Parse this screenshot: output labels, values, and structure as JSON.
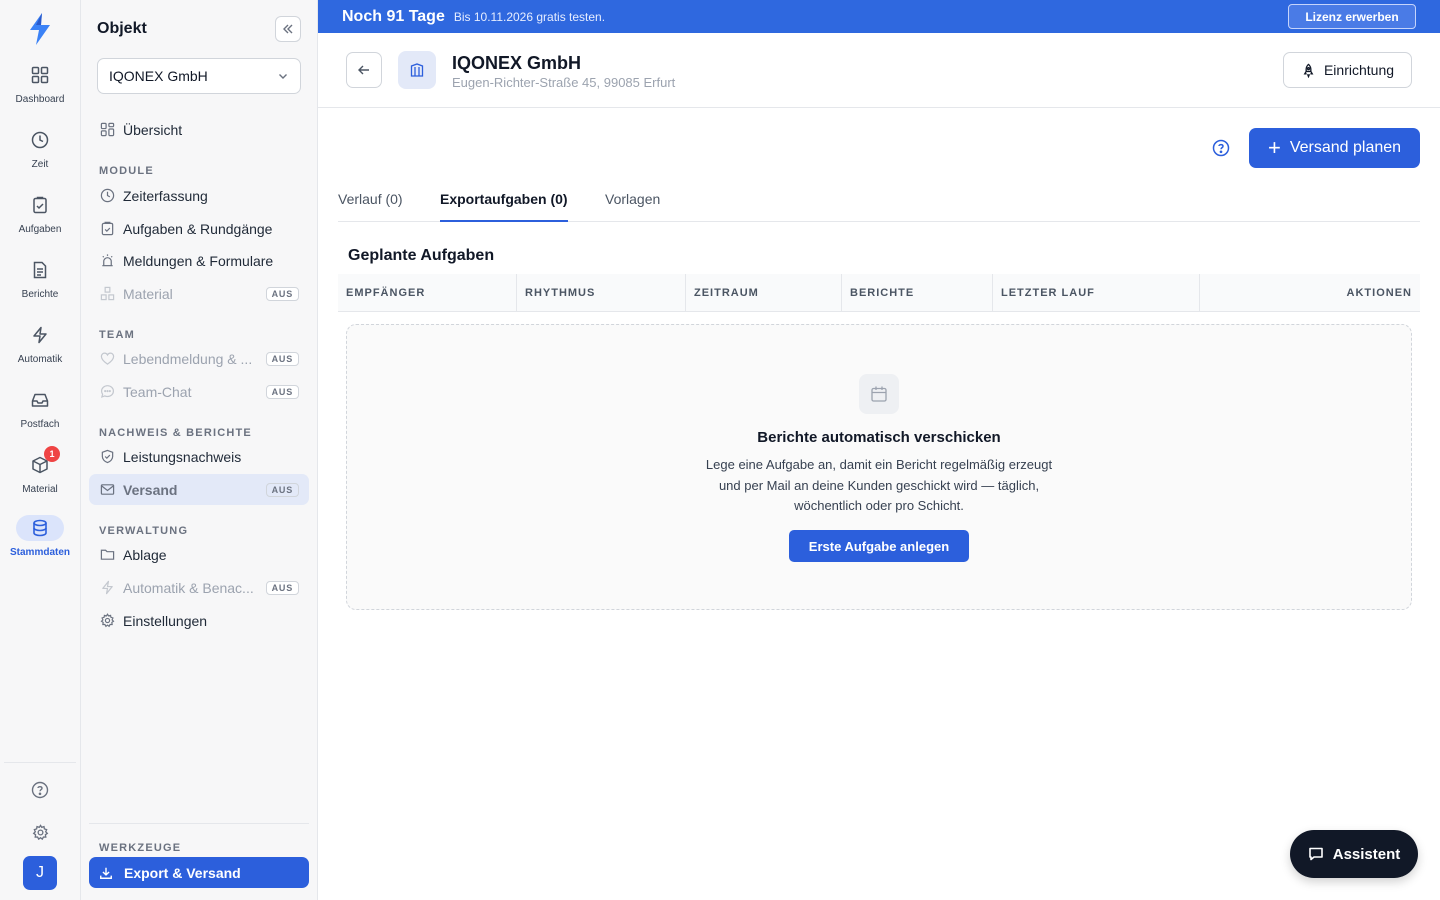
{
  "banner": {
    "title": "Noch 91 Tage",
    "subtitle": "Bis 10.11.2026 gratis testen.",
    "cta": "Lizenz erwerben"
  },
  "rail": {
    "items": [
      {
        "label": "Dashboard",
        "icon": "dashboard-icon"
      },
      {
        "label": "Zeit",
        "icon": "clock-icon"
      },
      {
        "label": "Aufgaben",
        "icon": "clipboard-icon"
      },
      {
        "label": "Berichte",
        "icon": "document-icon"
      },
      {
        "label": "Automatik",
        "icon": "bolt-icon"
      },
      {
        "label": "Postfach",
        "icon": "inbox-icon"
      },
      {
        "label": "Material",
        "icon": "box-icon",
        "badge": "1"
      },
      {
        "label": "Stammdaten",
        "icon": "database-icon",
        "active": true
      }
    ],
    "avatar": "J"
  },
  "panel": {
    "title": "Objekt",
    "selected_object": "IQONEX GmbH",
    "overview": "Übersicht",
    "sections": {
      "module": "MODULE",
      "team": "TEAM",
      "nachweis": "NACHWEIS & BERICHTE",
      "verwaltung": "VERWALTUNG",
      "werkzeuge": "WERKZEUGE"
    },
    "items": {
      "zeiterfassung": "Zeiterfassung",
      "aufgaben": "Aufgaben & Rundgänge",
      "meldungen": "Meldungen & Formulare",
      "material": "Material",
      "lebendmeldung": "Lebendmeldung & ...",
      "teamchat": "Team-Chat",
      "leistungsnachweis": "Leistungsnachweis",
      "versand": "Versand",
      "ablage": "Ablage",
      "automatik": "Automatik & Benac...",
      "einstellungen": "Einstellungen"
    },
    "off_badge": "AUS",
    "export": "Export & Versand"
  },
  "header": {
    "name": "IQONEX GmbH",
    "address": "Eugen-Richter-Straße 45, 99085 Erfurt",
    "setup_button": "Einrichtung"
  },
  "main": {
    "primary_button": "Versand planen",
    "tabs": [
      "Verlauf (0)",
      "Exportaufgaben (0)",
      "Vorlagen"
    ],
    "active_tab": "Exportaufgaben (0)",
    "section_title": "Geplante Aufgaben",
    "columns": [
      "EMPFÄNGER",
      "RHYTHMUS",
      "ZEITRAUM",
      "BERICHTE",
      "LETZTER LAUF",
      "AKTIONEN"
    ],
    "empty": {
      "title": "Berichte automatisch verschicken",
      "text": "Lege eine Aufgabe an, damit ein Bericht regelmäßig erzeugt und per Mail an deine Kunden geschickt wird — täglich, wöchentlich oder pro Schicht.",
      "button": "Erste Aufgabe anlegen"
    }
  },
  "assistant": {
    "label": "Assistent"
  },
  "colors": {
    "accent": "#2c5fdc",
    "banner": "#2f68df",
    "dark": "#111827",
    "badge": "#ef4444"
  }
}
